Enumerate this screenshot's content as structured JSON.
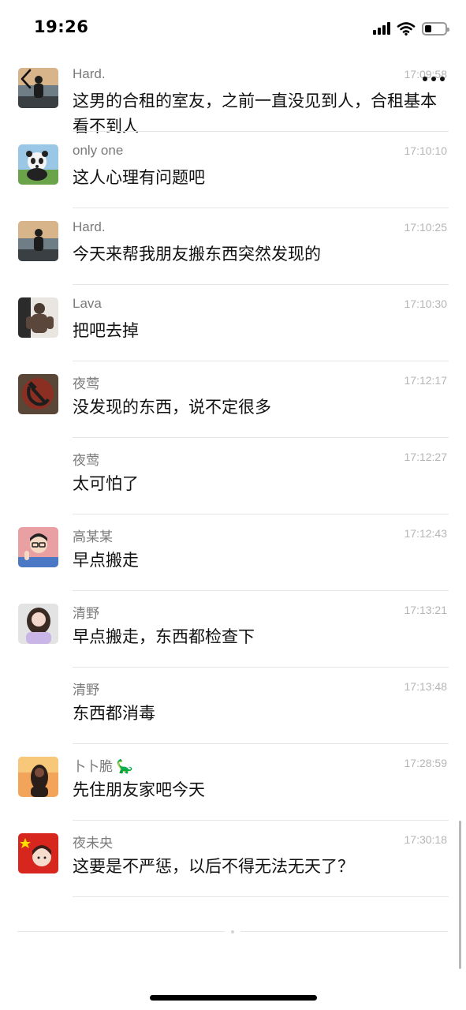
{
  "status_bar": {
    "time": "19:26",
    "icons": [
      "cellular-signal-icon",
      "wifi-icon",
      "battery-icon"
    ],
    "battery_level": 0.35
  },
  "header": {
    "back_icon": "chevron-left-icon",
    "more_icon": "ellipsis-icon"
  },
  "messages": [
    {
      "sender": "Hard.",
      "time": "17:09:58",
      "text": "这男的合租的室友，之前一直没见到人，合租基本看不到人",
      "avatar": "person-at-sea-avatar"
    },
    {
      "sender": "only one",
      "time": "17:10:10",
      "text": "这人心理有问题吧",
      "avatar": "panda-avatar"
    },
    {
      "sender": "Hard.",
      "time": "17:10:25",
      "text": "今天来帮我朋友搬东西突然发现的",
      "avatar": "person-at-sea-avatar"
    },
    {
      "sender": "Lava",
      "time": "17:10:30",
      "text": "把吧去掉",
      "avatar": "athlete-avatar"
    },
    {
      "sender": "夜莺",
      "time": "17:12:17",
      "text": "没发现的东西，说不定很多",
      "avatar": "hammer-sickle-avatar"
    },
    {
      "sender": "夜莺",
      "time": "17:12:27",
      "text": "太可怕了",
      "avatar": ""
    },
    {
      "sender": "高某某",
      "time": "17:12:43",
      "text": "早点搬走",
      "avatar": "cartoon-man-avatar"
    },
    {
      "sender": "清野",
      "time": "17:13:21",
      "text": "早点搬走，东西都检查下",
      "avatar": "girl-avatar"
    },
    {
      "sender": "清野",
      "time": "17:13:48",
      "text": "东西都消毒",
      "avatar": ""
    },
    {
      "sender": "卜卜脆 🦕",
      "time": "17:28:59",
      "text": "先住朋友家吧今天",
      "avatar": "sunset-girl-avatar"
    },
    {
      "sender": "夜未央",
      "time": "17:30:18",
      "text": "这要是不严惩，以后不得无法无天了？",
      "avatar": "flag-girl-avatar"
    }
  ]
}
